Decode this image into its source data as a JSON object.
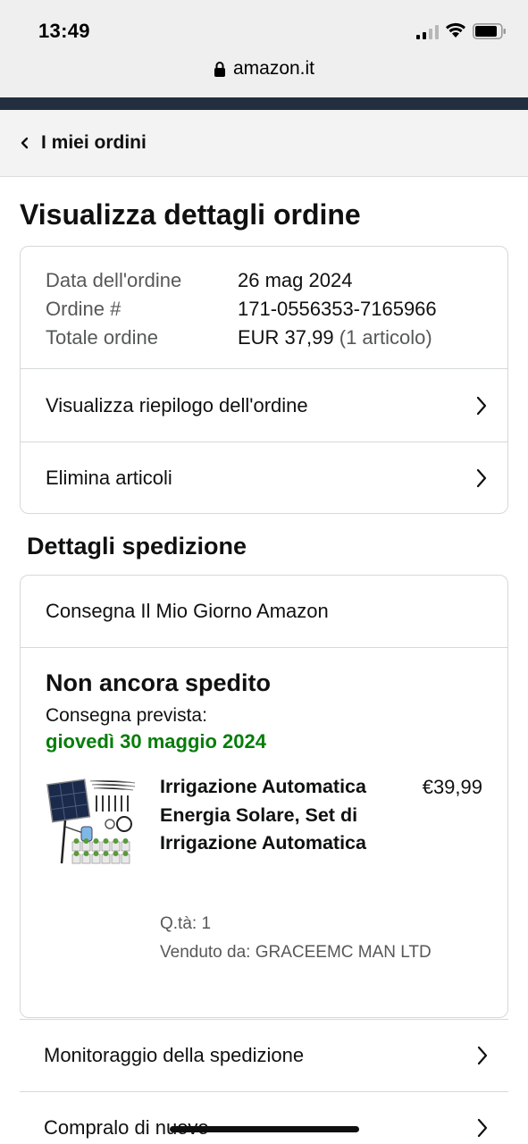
{
  "status_bar": {
    "time": "13:49"
  },
  "browser": {
    "url": "amazon.it"
  },
  "breadcrumb": {
    "label": "I miei ordini"
  },
  "page": {
    "title": "Visualizza dettagli ordine"
  },
  "order_summary": {
    "date_label": "Data dell'ordine",
    "date_value": "26 mag 2024",
    "number_label": "Ordine #",
    "number_value": "171-0556353-7165966",
    "total_label": "Totale ordine",
    "total_value": "EUR 37,99",
    "total_items": "(1 articolo)"
  },
  "order_links": {
    "view_summary": "Visualizza riepilogo dell'ordine",
    "delete_items": "Elimina articoli"
  },
  "shipment": {
    "section_title": "Dettagli spedizione",
    "delivery_type": "Consegna Il Mio Giorno Amazon",
    "status": "Non ancora spedito",
    "expected_label": "Consegna prevista:",
    "expected_date": "giovedì 30 maggio 2024",
    "status_color": "#067d0a"
  },
  "product": {
    "title": "Irrigazione Automatica Energia Solare, Set di Irrigazione Automatica",
    "price": "€39,99",
    "quantity": "Q.tà: 1",
    "seller": "Venduto da: GRACEEMC MAN LTD"
  },
  "actions": {
    "track": "Monitoraggio della spedizione",
    "buy_again": "Compralo di nuovo"
  },
  "colors": {
    "nav": "#232f3e",
    "text": "#0f1111",
    "secondary": "#565959",
    "border": "#d5d9d9"
  }
}
